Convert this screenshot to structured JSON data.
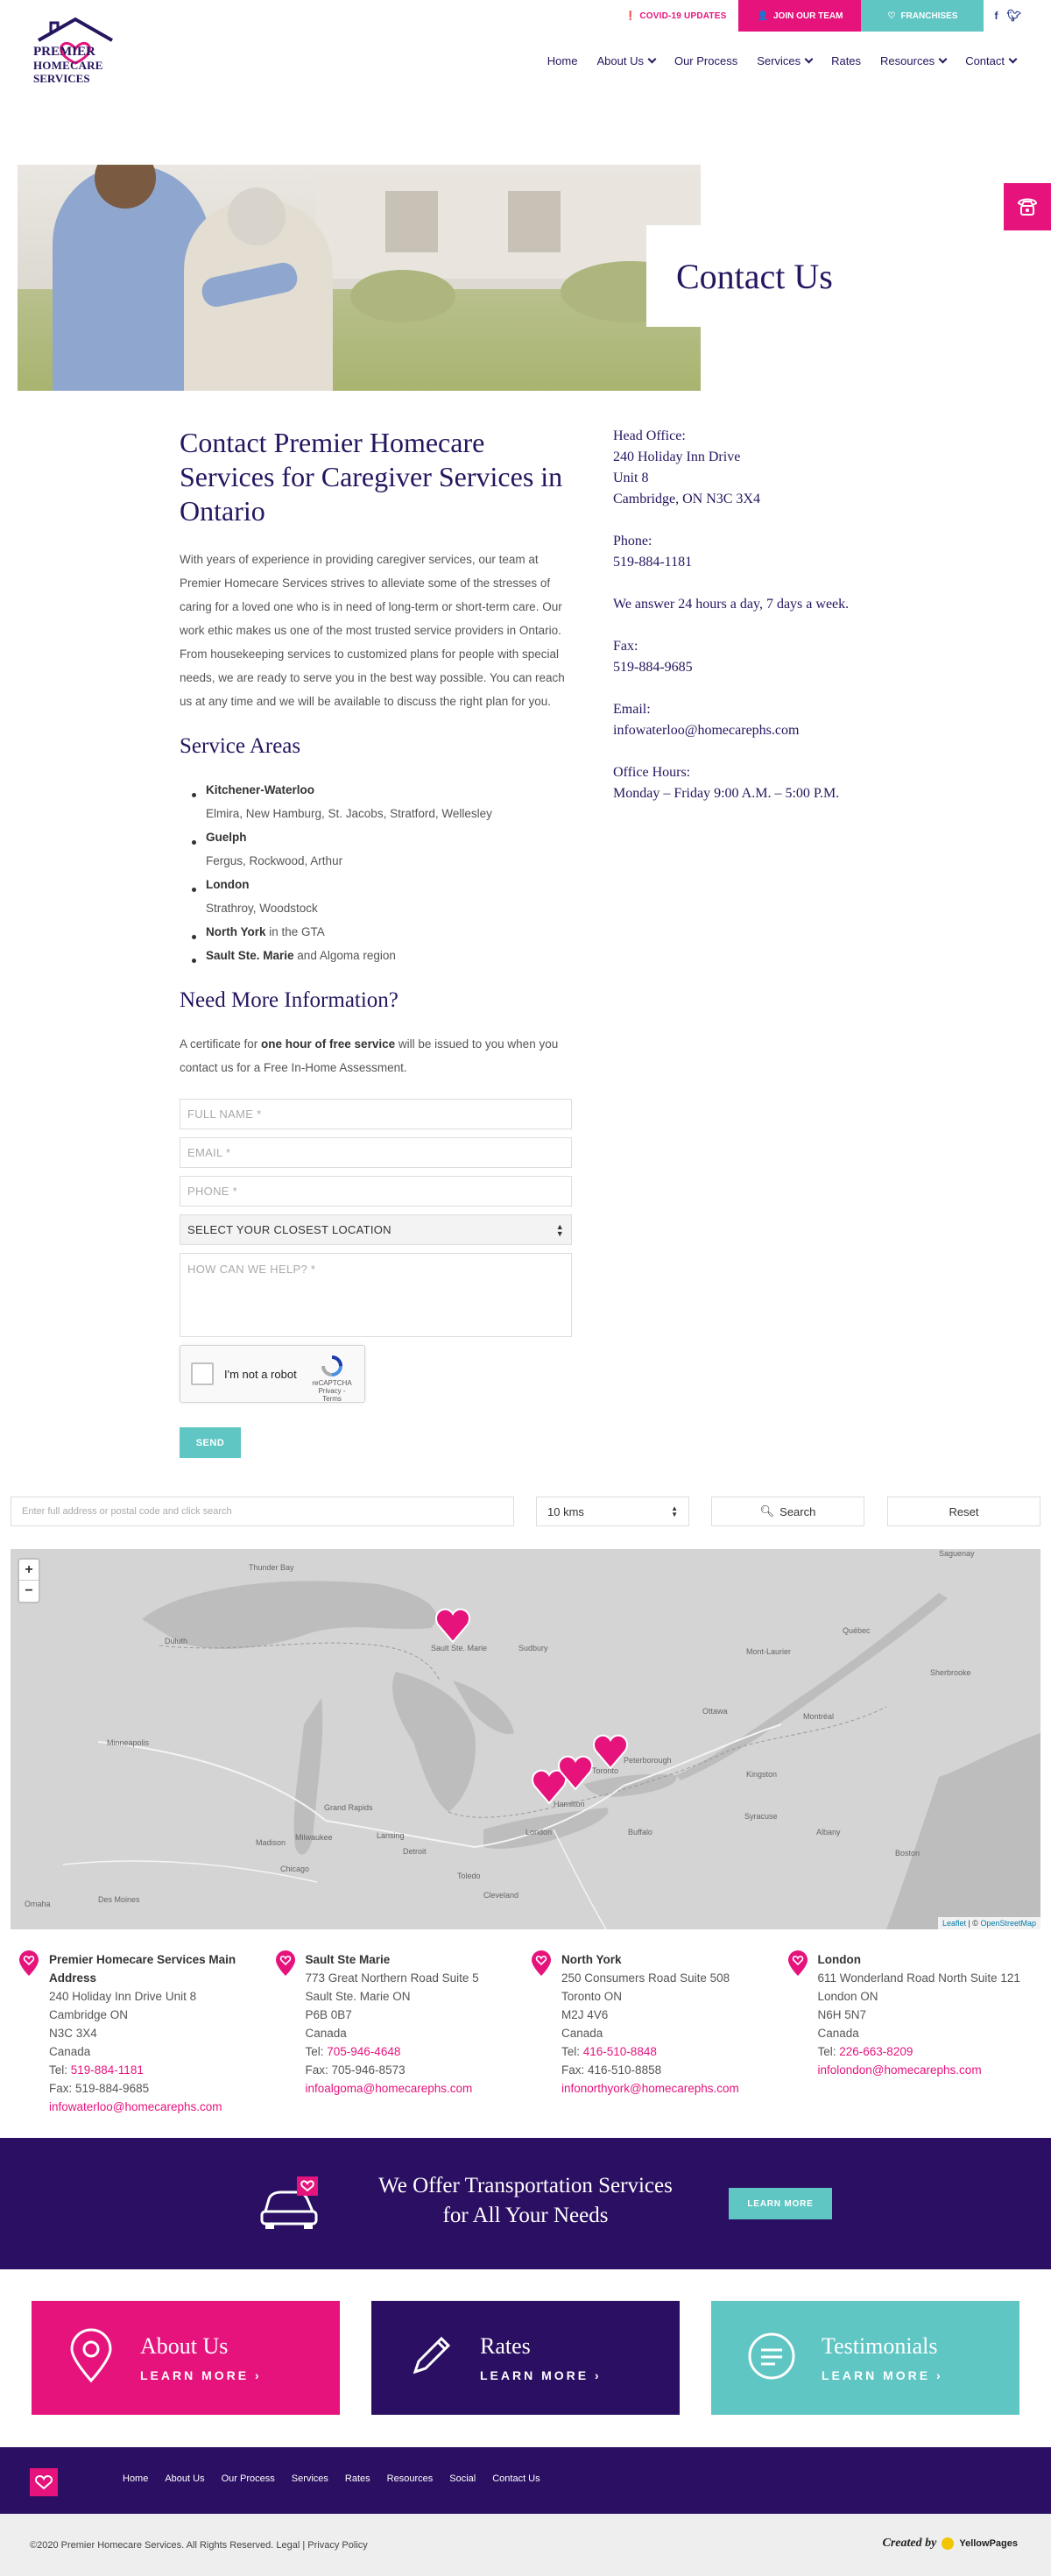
{
  "topbar": {
    "covid": "COVID-19 UPDATES",
    "join": "JOIN OUR TEAM",
    "franchises": "FRANCHISES",
    "facebook": "f",
    "twitter": "t"
  },
  "logo": {
    "line1": "PREMIER",
    "line2": "HOMECARE",
    "line3": "SERVICES"
  },
  "nav": {
    "items": [
      {
        "label": "Home",
        "caret": false
      },
      {
        "label": "About Us",
        "caret": true
      },
      {
        "label": "Our Process",
        "caret": false
      },
      {
        "label": "Services",
        "caret": true
      },
      {
        "label": "Rates",
        "caret": false
      },
      {
        "label": "Resources",
        "caret": true
      },
      {
        "label": "Contact",
        "caret": true
      }
    ]
  },
  "hero": {
    "title": "Contact Us"
  },
  "content": {
    "heading": "Contact Premier Homecare Services for Caregiver Services in Ontario",
    "intro": "With years of experience in providing caregiver services, our team at Premier Homecare Services strives to alleviate some of the stresses of caring for a loved one who is in need of long-term or short-term care. Our work ethic makes us one of the most trusted service providers in Ontario. From housekeeping services to customized plans for people with special needs, we are ready to serve you in the best way possible. You can reach us at any time and we will be available to discuss the right plan for you.",
    "areas_heading": "Service Areas",
    "areas": [
      {
        "name": "Kitchener-Waterloo",
        "detail": "Elmira, New Hamburg, St. Jacobs, Stratford, Wellesley",
        "suffix": ""
      },
      {
        "name": "Guelph",
        "detail": "Fergus, Rockwood, Arthur",
        "suffix": ""
      },
      {
        "name": "London",
        "detail": "Strathroy, Woodstock",
        "suffix": ""
      },
      {
        "name": "North York",
        "detail": "",
        "suffix": " in the GTA"
      },
      {
        "name": "Sault Ste. Marie",
        "detail": "",
        "suffix": " and Algoma region"
      }
    ],
    "info_heading": "Need More Information?",
    "cert_pre": "A certificate for ",
    "cert_bold": "one hour of free service",
    "cert_post": " will be issued to you when you contact us for a Free In-Home Assessment."
  },
  "form": {
    "name_ph": "FULL NAME *",
    "email_ph": "EMAIL *",
    "phone_ph": "PHONE *",
    "location_value": "SELECT YOUR CLOSEST LOCATION",
    "help_ph": "HOW CAN WE HELP? *",
    "recaptcha_label": "I'm not a robot",
    "recaptcha_brand": "reCAPTCHA",
    "recaptcha_terms": "Privacy - Terms",
    "send": "SEND"
  },
  "office": {
    "head_label": "Head Office:",
    "addr1": "240 Holiday Inn Drive",
    "addr2": "Unit 8",
    "addr3": "Cambridge, ON N3C 3X4",
    "phone_label": "Phone:",
    "phone": "519-884-1181",
    "answer": "We answer 24 hours a day, 7 days a week.",
    "fax_label": "Fax:",
    "fax": "519-884-9685",
    "email_label": "Email:",
    "email": "infowaterloo@homecarephs.com",
    "hours_label": "Office Hours:",
    "hours": "Monday – Friday 9:00 A.M. – 5:00 P.M."
  },
  "map_search": {
    "placeholder": "Enter full address or postal code and click search",
    "radius": "10 kms",
    "search": "Search",
    "reset": "Reset"
  },
  "map": {
    "attribution_leaflet": "Leaflet",
    "attribution_osm": "OpenStreetMap",
    "labels": [
      {
        "t": "Thunder Bay"
      },
      {
        "t": "Duluth"
      },
      {
        "t": "Minneapolis"
      },
      {
        "t": "Madison"
      },
      {
        "t": "Milwaukee"
      },
      {
        "t": "Chicago"
      },
      {
        "t": "Grand Rapids"
      },
      {
        "t": "Lansing"
      },
      {
        "t": "Detroit"
      },
      {
        "t": "Toledo"
      },
      {
        "t": "Cleveland"
      },
      {
        "t": "Sudbury"
      },
      {
        "t": "Ottawa"
      },
      {
        "t": "Montréal"
      },
      {
        "t": "Québec"
      },
      {
        "t": "Kingston"
      },
      {
        "t": "Buffalo"
      },
      {
        "t": "Syracuse"
      },
      {
        "t": "Albany"
      },
      {
        "t": "Boston"
      },
      {
        "t": "Des Moines"
      },
      {
        "t": "Omaha"
      },
      {
        "t": "Hamilton"
      },
      {
        "t": "Toronto"
      },
      {
        "t": "London"
      },
      {
        "t": "Sault Ste. Marie"
      },
      {
        "t": "Peterborough"
      },
      {
        "t": "Saguenay"
      },
      {
        "t": "Sherbrooke"
      },
      {
        "t": "Mont-Laurier"
      }
    ]
  },
  "locations": [
    {
      "title": "Premier Homecare Services Main Address",
      "lines": [
        "240 Holiday Inn Drive Unit 8",
        "Cambridge ON",
        "N3C 3X4",
        "Canada"
      ],
      "tel": "519-884-1181",
      "fax": "519-884-9685",
      "email": "infowaterloo@homecarephs.com"
    },
    {
      "title": "Sault Ste Marie",
      "lines": [
        "773 Great Northern Road Suite 5",
        "Sault Ste. Marie ON",
        "P6B 0B7",
        "Canada"
      ],
      "tel": "705-946-4648",
      "fax": "705-946-8573",
      "email": "infoalgoma@homecarephs.com"
    },
    {
      "title": "North York",
      "lines": [
        "250 Consumers Road Suite 508",
        "Toronto ON",
        "M2J 4V6",
        "Canada"
      ],
      "tel": "416-510-8848",
      "fax": "416-510-8858",
      "email": "infonorthyork@homecarephs.com"
    },
    {
      "title": "London",
      "lines": [
        "611 Wonderland Road North Suite 121",
        "London ON",
        "N6H 5N7",
        "Canada"
      ],
      "tel": "226-663-8209",
      "fax": "",
      "email": "infolondon@homecarephs.com"
    }
  ],
  "loc_labels": {
    "tel": "Tel: ",
    "fax": "Fax: "
  },
  "transport": {
    "line1": "We Offer Transportation Services",
    "line2": "for All Your Needs",
    "button": "LEARN MORE"
  },
  "cards": [
    {
      "title": "About Us",
      "cta": "LEARN MORE",
      "color": "#e6137d"
    },
    {
      "title": "Rates",
      "cta": "LEARN MORE",
      "color": "#2a0f62"
    },
    {
      "title": "Testimonials",
      "cta": "LEARN MORE",
      "color": "#5fc6c4"
    }
  ],
  "footer": {
    "nav": [
      "Home",
      "About Us",
      "Our Process",
      "Services",
      "Rates",
      "Resources",
      "Social",
      "Contact Us"
    ],
    "copyright": "©2020 Premier Homecare Services. All Rights Reserved. ",
    "legal": "Legal",
    "sep": " | ",
    "privacy": "Privacy Policy",
    "created_by": "Created by",
    "yp": "YellowPages"
  },
  "colors": {
    "pink": "#e6137d",
    "teal": "#5fc6c4",
    "navy": "#2a0f62",
    "heading": "#26155f"
  }
}
